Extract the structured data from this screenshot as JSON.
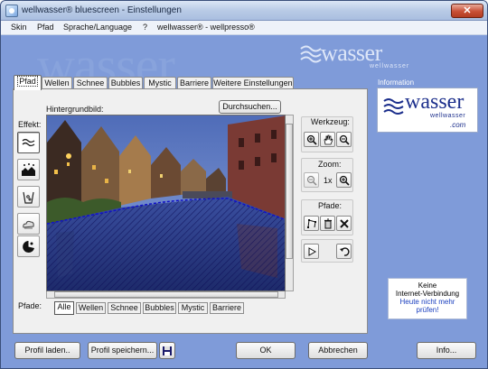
{
  "window": {
    "title": "wellwasser® bluescreen - Einstellungen",
    "close": "✕"
  },
  "menu": [
    "Skin",
    "Pfad",
    "Sprache/Language",
    "?",
    "wellwasser® - wellpresso®"
  ],
  "branding": {
    "watermark": "wasser",
    "logo_word": "wasser",
    "logo_sub": "wellwasser",
    "logo_suffix": ".com"
  },
  "tabs": [
    "Pfad",
    "Wellen",
    "Schnee",
    "Bubbles",
    "Mystic",
    "Barriere",
    "Weitere Einstellungen"
  ],
  "panel": {
    "effekt_label": "Effekt:",
    "background_label": "Hintergrundbild:",
    "browse_label": "Durchsuchen...",
    "werkzeug_label": "Werkzeug:",
    "zoom_label": "Zoom:",
    "zoom_value": "1x",
    "pfade_label": "Pfade:",
    "pfade_bottom_label": "Pfade:",
    "path_tabs": [
      "Alle",
      "Wellen",
      "Schnee",
      "Bubbles",
      "Mystic",
      "Barriere"
    ]
  },
  "info": {
    "title": "Information",
    "line1": "Keine",
    "line2": "Internet-Verbindung",
    "link": "Heute nicht mehr prüfen!"
  },
  "bottom": {
    "load": "Profil laden..",
    "save": "Profil speichern...",
    "ok": "OK",
    "cancel": "Abbrechen",
    "info": "Info..."
  },
  "colors": {
    "window_bg": "#7f9bd9",
    "panel_bg": "#f0f0f0",
    "link": "#1a3fbf",
    "path_overlay": "#1c1c8a"
  }
}
